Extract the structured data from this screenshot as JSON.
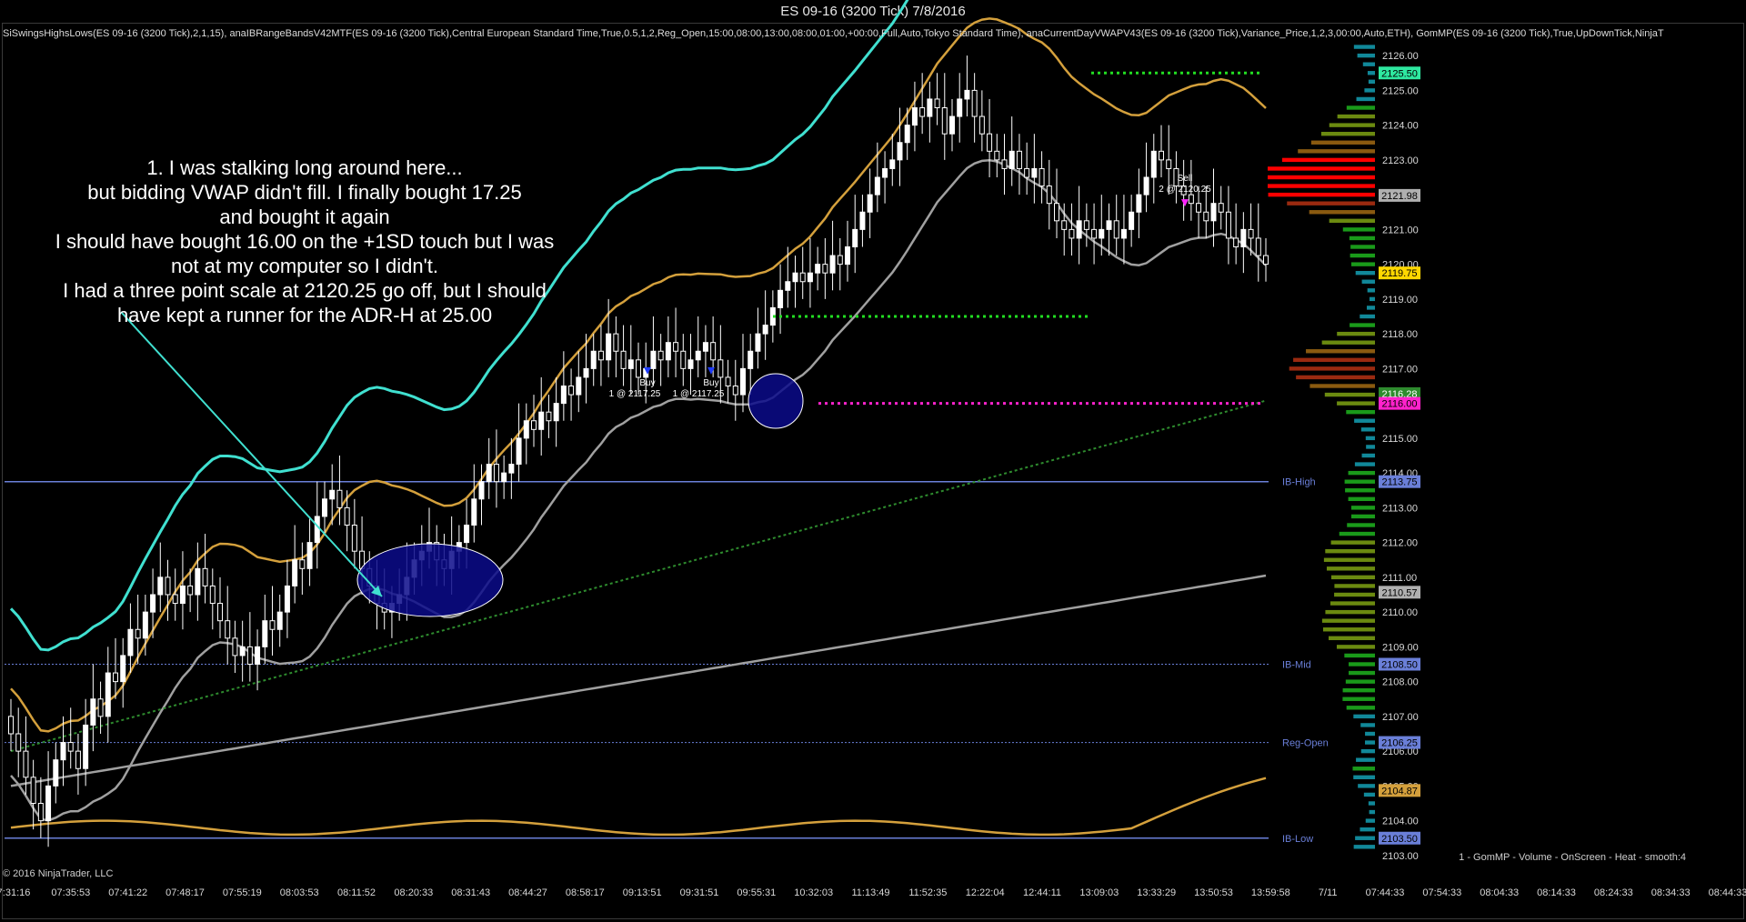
{
  "window": {
    "title": "ES 09-16 (3200 Tick)  7/8/2016"
  },
  "indicator_line": "SiSwingsHighsLows(ES 09-16 (3200 Tick),2,1,15), anaIBRangeBandsV42MTF(ES 09-16 (3200 Tick),Central European Standard Time,True,0.5,1,2,Reg_Open,15:00,08:00,13:00,08:00,01:00,+00:00,Full,Auto,Tokyo Standard Time), anaCurrentDayVWAPV43(ES 09-16 (3200 Tick),Variance_Price,1,2,3,00:00,Auto,ETH), GomMP(ES 09-16 (3200 Tick),True,UpDownTick,NinjaT",
  "copyright": "© 2016 NinjaTrader, LLC",
  "profile_label": "1 - GomMP - Volume - OnScreen - Heat - smooth:4",
  "annotation": [
    "1. I was stalking long around here...",
    "but bidding VWAP didn't fill. I finally bought 17.25",
    "and bought it again",
    "I should have bought 16.00 on the +1SD touch but I was",
    "not at my computer so I didn't.",
    "I had a three point scale at 2120.25 go off, but I should",
    "have kept a runner for the ADR-H at 25.00"
  ],
  "colors": {
    "background": "#000000",
    "band_outer": "#40e0d0",
    "band_inner": "#d4a03c",
    "vwap": "#a0a0a0",
    "vwap_lower": "#d4a03c",
    "green_dotted": "#2e8b2e",
    "ib_line": "#6a7fd8",
    "candle": "#ffffff",
    "buy_arrow": "#1e3cff",
    "sell_arrow": "#ff22ff",
    "green_level": "#22dd22",
    "magenta_level": "#ff22cc",
    "ellipse_fill": "#0a0a8a",
    "pointer_line": "#40e0d0"
  },
  "chart_data": {
    "type": "candlestick",
    "ylim": [
      2102.5,
      2126.5
    ],
    "y_ticks": [
      2103,
      2104,
      2105,
      2106,
      2107,
      2108,
      2109,
      2110,
      2111,
      2112,
      2113,
      2114,
      2115,
      2116,
      2117,
      2118,
      2119,
      2120,
      2121,
      2122,
      2123,
      2124,
      2125,
      2126
    ],
    "x_tick_labels": [
      "7:31:16",
      "07:35:53",
      "07:41:22",
      "07:48:17",
      "07:55:19",
      "08:03:53",
      "08:11:52",
      "08:20:33",
      "08:31:43",
      "08:44:27",
      "08:58:17",
      "09:13:51",
      "09:31:51",
      "09:55:31",
      "10:32:03",
      "11:13:49",
      "11:52:35",
      "12:22:04",
      "12:44:11",
      "13:09:03",
      "13:33:29",
      "13:50:53",
      "13:59:58",
      "7/11",
      "07:44:33",
      "07:54:33",
      "08:04:33",
      "08:14:33",
      "08:24:33",
      "08:34:33",
      "08:44:33"
    ],
    "closes": [
      2106.5,
      2106.0,
      2105.25,
      2104.5,
      2104.0,
      2105.0,
      2105.75,
      2106.25,
      2106.0,
      2105.5,
      2106.75,
      2107.5,
      2107.0,
      2108.25,
      2108.0,
      2108.75,
      2109.5,
      2109.25,
      2110.0,
      2110.5,
      2111.0,
      2110.5,
      2110.25,
      2110.75,
      2110.5,
      2111.25,
      2110.75,
      2110.25,
      2109.75,
      2109.25,
      2108.75,
      2109.0,
      2108.5,
      2109.0,
      2109.75,
      2109.5,
      2110.0,
      2110.75,
      2111.5,
      2111.25,
      2112.0,
      2112.75,
      2113.25,
      2113.5,
      2113.0,
      2112.5,
      2111.75,
      2111.25,
      2110.75,
      2110.25,
      2110.0,
      2110.25,
      2110.5,
      2111.0,
      2111.5,
      2111.75,
      2112.0,
      2111.5,
      2111.25,
      2111.75,
      2112.0,
      2112.5,
      2113.25,
      2113.75,
      2114.25,
      2113.75,
      2114.0,
      2114.25,
      2115.0,
      2115.5,
      2115.25,
      2115.75,
      2115.5,
      2116.0,
      2116.5,
      2116.25,
      2116.75,
      2117.0,
      2117.5,
      2117.25,
      2118.0,
      2117.5,
      2117.0,
      2117.25,
      2116.75,
      2117.0,
      2117.5,
      2117.25,
      2117.75,
      2117.5,
      2117.0,
      2117.25,
      2117.5,
      2117.75,
      2117.25,
      2116.75,
      2116.5,
      2116.25,
      2117.0,
      2117.5,
      2118.0,
      2118.25,
      2118.75,
      2119.25,
      2119.5,
      2119.75,
      2119.5,
      2119.75,
      2120.0,
      2119.75,
      2120.25,
      2120.0,
      2120.5,
      2121.0,
      2121.5,
      2122.0,
      2122.5,
      2122.75,
      2123.0,
      2123.5,
      2124.0,
      2124.5,
      2124.25,
      2124.75,
      2124.5,
      2123.75,
      2124.25,
      2124.75,
      2125.0,
      2124.25,
      2123.75,
      2123.25,
      2123.0,
      2122.75,
      2123.25,
      2122.75,
      2122.5,
      2122.75,
      2122.25,
      2121.75,
      2121.25,
      2121.0,
      2120.75,
      2121.25,
      2121.0,
      2120.75,
      2121.0,
      2121.25,
      2120.75,
      2121.0,
      2121.5,
      2122.0,
      2122.5,
      2123.25,
      2123.0,
      2122.75,
      2122.25,
      2122.0,
      2121.75,
      2121.5,
      2121.25,
      2121.75,
      2121.5,
      2120.75,
      2120.5,
      2121.0,
      2120.75,
      2120.25,
      2120.0
    ],
    "vwap": {
      "name": "",
      "values_start": 2105.5,
      "values_end": 2121.98
    },
    "bands_upper_outer_end": 2126.75,
    "levels": [
      {
        "label": "IB-High",
        "value": 2113.75
      },
      {
        "label": "IB-Mid",
        "value": 2108.5
      },
      {
        "label": "Reg-Open",
        "value": 2106.25
      },
      {
        "label": "IB-Low",
        "value": 2103.5
      }
    ],
    "price_boxes": [
      {
        "value": "2125.50",
        "bg": "#2ee8a0",
        "fg": "#000000"
      },
      {
        "value": "2121.98",
        "bg": "#b0b0b0",
        "fg": "#000000"
      },
      {
        "value": "2119.75",
        "bg": "#ffd700",
        "fg": "#000000"
      },
      {
        "value": "2116.28",
        "bg": "#2e8b2e",
        "fg": "#ffffff"
      },
      {
        "value": "2116.00",
        "bg": "#ff22cc",
        "fg": "#000000"
      },
      {
        "value": "2113.75",
        "bg": "#6a7fd8",
        "fg": "#000000"
      },
      {
        "value": "2110.57",
        "bg": "#b0b0b0",
        "fg": "#000000"
      },
      {
        "value": "2108.50",
        "bg": "#6a7fd8",
        "fg": "#000000"
      },
      {
        "value": "2106.25",
        "bg": "#6a7fd8",
        "fg": "#000000"
      },
      {
        "value": "2104.87",
        "bg": "#d4a03c",
        "fg": "#000000"
      },
      {
        "value": "2103.50",
        "bg": "#6a7fd8",
        "fg": "#000000"
      }
    ],
    "trades": [
      {
        "side": "Buy",
        "text": "1 @ 2117.25",
        "price": 2117.25
      },
      {
        "side": "Buy",
        "text": "1 @ 2117.25",
        "price": 2117.25
      },
      {
        "side": "Sell",
        "text": "2 @ 2120.25",
        "price": 2120.25
      }
    ],
    "horizontal_markers": [
      {
        "price": 2125.5,
        "color": "green"
      },
      {
        "price": 2118.5,
        "color": "green"
      },
      {
        "price": 2116.0,
        "color": "magenta"
      }
    ],
    "volume_profile": {
      "peak_price": 2122.5,
      "secondary_peak": 2117.0
    }
  }
}
